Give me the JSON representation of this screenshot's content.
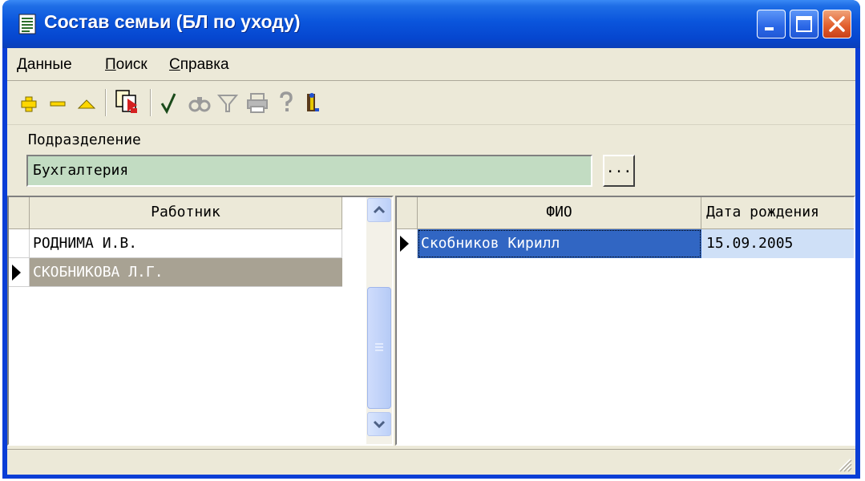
{
  "window": {
    "title": "Состав семьи (БЛ по уходу)"
  },
  "menu": {
    "items": [
      {
        "label": "Данные",
        "accel": "Д",
        "rest": "анные"
      },
      {
        "label": "Поиск",
        "accel": "П",
        "rest": "оиск"
      },
      {
        "label": "Справка",
        "accel": "С",
        "rest": "правка"
      }
    ]
  },
  "toolbar": {
    "icons": [
      "add-icon",
      "delete-icon",
      "edit-icon",
      "export-icon",
      "apply-check-icon",
      "find-icon",
      "filter-icon",
      "print-icon",
      "help-icon",
      "exit-icon"
    ]
  },
  "department": {
    "label": "Подразделение",
    "value": "Бухгалтерия",
    "button": "..."
  },
  "employees": {
    "header": "Работник",
    "rows": [
      {
        "name": "РОДНИМА И.В.",
        "selected": false
      },
      {
        "name": "СКОБНИКОВА Л.Г.",
        "selected": true
      }
    ]
  },
  "family": {
    "headers": [
      "ФИО",
      "Дата рождения"
    ],
    "rows": [
      {
        "fio": "Скобников Кирилл",
        "birth_date": "15.09.2005",
        "selected": true
      }
    ]
  },
  "colors": {
    "titlebar": "#0a55dc",
    "selection_blue": "#3166c3",
    "selection_gray": "#a8a293",
    "field_green": "#c2dcc2",
    "cell_highlight": "#cfe0f7"
  }
}
